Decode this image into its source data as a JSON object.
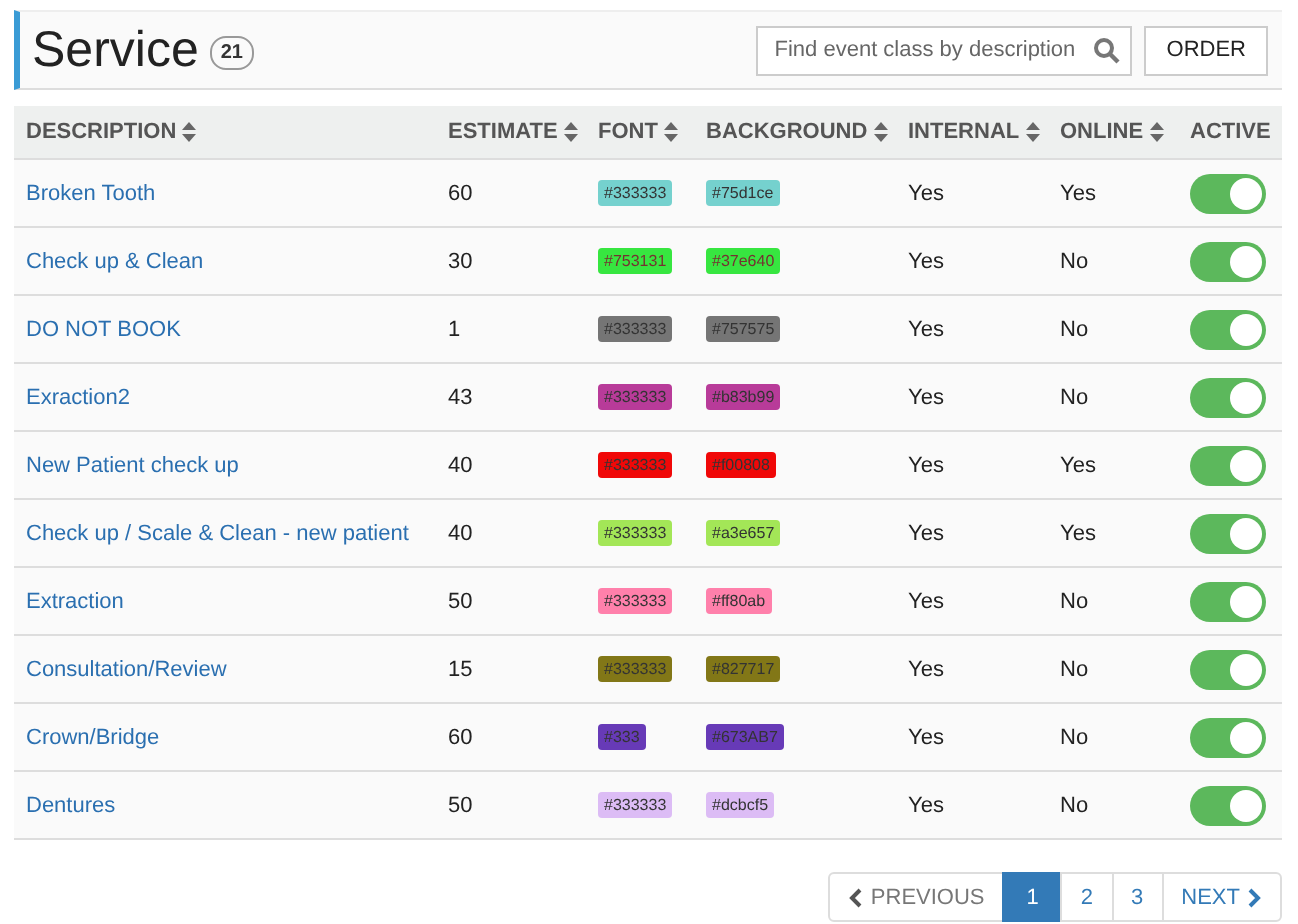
{
  "header": {
    "title": "Service",
    "count": "21",
    "search": {
      "placeholder": "Find event class by description"
    },
    "order_button": "ORDER"
  },
  "table": {
    "columns": [
      {
        "label": "DESCRIPTION",
        "sortable": true
      },
      {
        "label": "ESTIMATE",
        "sortable": true
      },
      {
        "label": "FONT",
        "sortable": true
      },
      {
        "label": "BACKGROUND",
        "sortable": true
      },
      {
        "label": "INTERNAL",
        "sortable": true
      },
      {
        "label": "ONLINE",
        "sortable": true
      },
      {
        "label": "ACTIVE",
        "sortable": false
      }
    ],
    "rows": [
      {
        "description": "Broken Tooth",
        "estimate": "60",
        "font": "#333333",
        "background": "#75d1ce",
        "internal": "Yes",
        "online": "Yes",
        "active": true
      },
      {
        "description": "Check up & Clean",
        "estimate": "30",
        "font": "#753131",
        "background": "#37e640",
        "internal": "Yes",
        "online": "No",
        "active": true
      },
      {
        "description": "DO NOT BOOK",
        "estimate": "1",
        "font": "#333333",
        "background": "#757575",
        "internal": "Yes",
        "online": "No",
        "active": true
      },
      {
        "description": "Exraction2",
        "estimate": "43",
        "font": "#333333",
        "background": "#b83b99",
        "internal": "Yes",
        "online": "No",
        "active": true
      },
      {
        "description": "New Patient check up",
        "estimate": "40",
        "font": "#333333",
        "background": "#f00808",
        "internal": "Yes",
        "online": "Yes",
        "active": true
      },
      {
        "description": "Check up / Scale & Clean - new patient",
        "estimate": "40",
        "font": "#333333",
        "background": "#a3e657",
        "internal": "Yes",
        "online": "Yes",
        "active": true
      },
      {
        "description": "Extraction",
        "estimate": "50",
        "font": "#333333",
        "background": "#ff80ab",
        "internal": "Yes",
        "online": "No",
        "active": true
      },
      {
        "description": "Consultation/Review",
        "estimate": "15",
        "font": "#333333",
        "background": "#827717",
        "internal": "Yes",
        "online": "No",
        "active": true
      },
      {
        "description": "Crown/Bridge",
        "estimate": "60",
        "font": "#333",
        "background": "#673AB7",
        "internal": "Yes",
        "online": "No",
        "active": true
      },
      {
        "description": "Dentures",
        "estimate": "50",
        "font": "#333333",
        "background": "#dcbcf5",
        "internal": "Yes",
        "online": "No",
        "active": true
      }
    ]
  },
  "pagination": {
    "previous": "PREVIOUS",
    "next": "NEXT",
    "pages": [
      {
        "label": "1",
        "selected": true
      },
      {
        "label": "2",
        "selected": false
      },
      {
        "label": "3",
        "selected": false
      }
    ]
  }
}
